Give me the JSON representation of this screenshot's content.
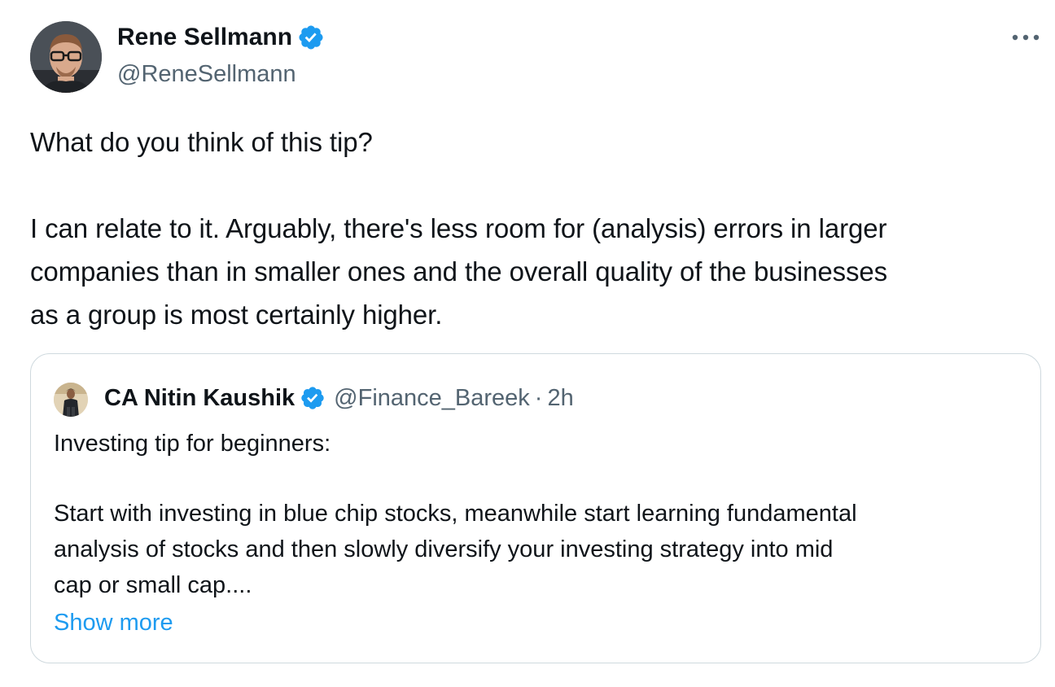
{
  "tweet": {
    "author": {
      "name": "Rene Sellmann",
      "handle": "@ReneSellmann",
      "verified": true
    },
    "text_line1": "What do you think of this tip?",
    "text_line2": "I can relate to it. Arguably, there's less room for (analysis) errors in larger",
    "text_line3": "companies than in smaller ones and the overall quality of the businesses",
    "text_line4": "as a group is most certainly higher.",
    "more_icon": "more-horizontal-icon"
  },
  "quote": {
    "author": {
      "name": "CA Nitin Kaushik",
      "handle": "@Finance_Bareek",
      "separator": "·",
      "time": "2h",
      "verified": true
    },
    "text_line1": "Investing tip for beginners:",
    "text_line2": "Start with investing in blue chip stocks, meanwhile start learning fundamental",
    "text_line3": "analysis of stocks and then slowly diversify your investing strategy into mid",
    "text_line4": "cap or small cap....",
    "show_more": "Show more"
  },
  "colors": {
    "text_primary": "#0f1419",
    "text_secondary": "#536471",
    "link": "#1d9bf0",
    "verified": "#1d9bf0",
    "border": "#cfd9de"
  }
}
